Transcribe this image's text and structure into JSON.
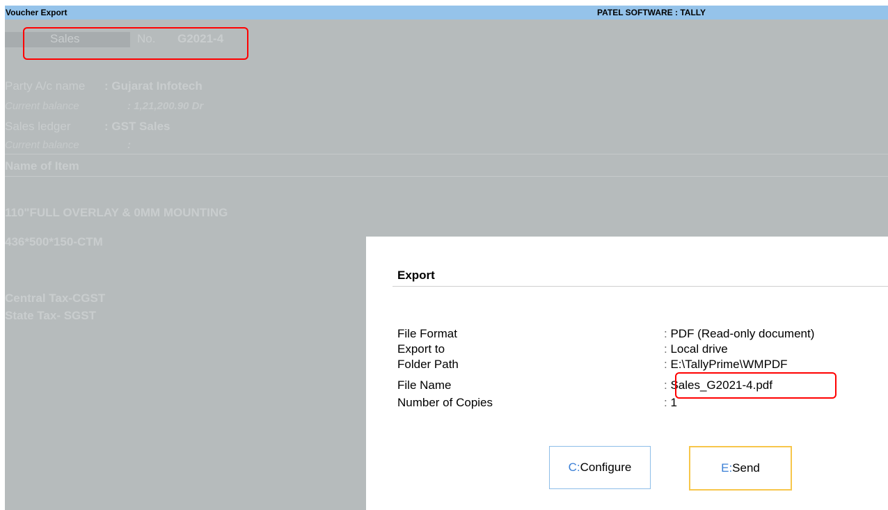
{
  "titlebar": {
    "left": "Voucher Export",
    "center": "PATEL SOFTWARE : TALLY"
  },
  "voucher": {
    "type": "Sales",
    "no_label": "No.",
    "number": "G2021-4"
  },
  "party": {
    "label": "Party A/c name",
    "value": ": Gujarat Infotech",
    "balance_label": "Current balance",
    "balance_value": ":   1,21,200.90 Dr"
  },
  "sales_ledger": {
    "label": "Sales ledger",
    "value": ": GST Sales",
    "balance_label": "Current balance",
    "balance_value": ":"
  },
  "items_header": "Name of Item",
  "items": [
    "110\"FULL OVERLAY & 0MM MOUNTING",
    "436*500*150-CTM"
  ],
  "taxes": [
    "Central Tax-CGST",
    "State Tax- SGST"
  ],
  "dialog": {
    "title": "Export",
    "rows": [
      {
        "label": "File Format",
        "value": "PDF (Read-only document)"
      },
      {
        "label": "Export to",
        "value": "Local drive"
      },
      {
        "label": "Folder Path",
        "value": "E:\\TallyPrime\\WMPDF"
      },
      {
        "label": "File Name",
        "value": "Sales_G2021-4.pdf"
      },
      {
        "label": "Number of Copies",
        "value": "1"
      }
    ],
    "configure_key": "C:",
    "configure_label": " Configure",
    "send_key": "E:",
    "send_label": " Send"
  },
  "colors": {
    "titlebar": "#95c3ea",
    "background": "#b6bbbc",
    "highlight": "#ff0000",
    "send_border": "#f7c64a",
    "configure_border": "#8dbde8"
  }
}
